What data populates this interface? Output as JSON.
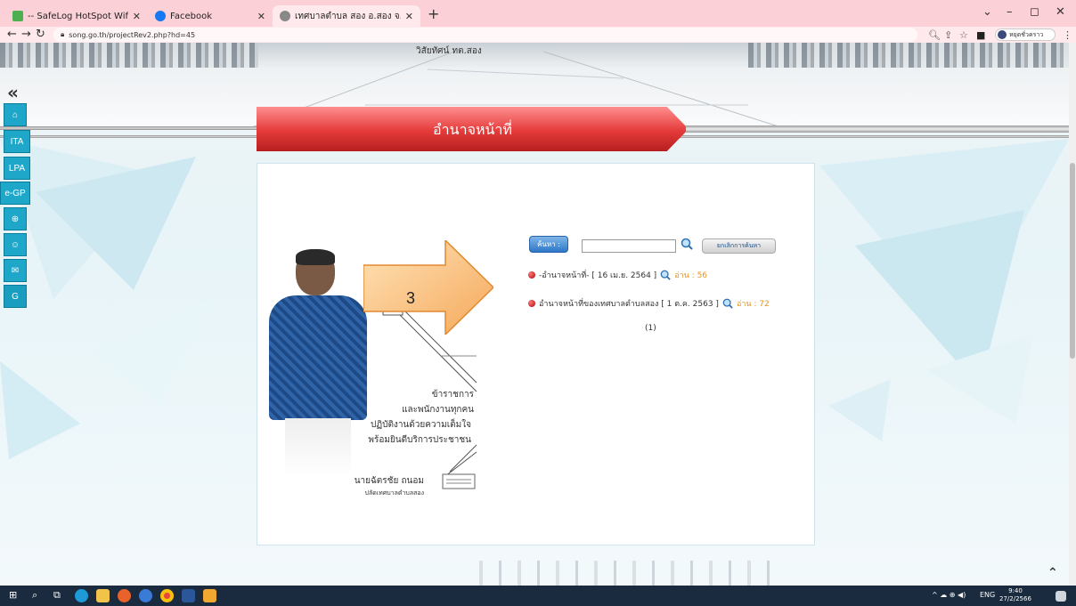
{
  "browser": {
    "tabs": [
      {
        "title": "-- SafeLog HotSpot Wifi Interne",
        "favicon_color": "#4caf50"
      },
      {
        "title": "Facebook",
        "favicon_color": "#1877f2"
      },
      {
        "title": "เทศบาลตำบล สอง อ.สอง จ.แพร่ Build",
        "favicon_color": "#888888"
      }
    ],
    "new_tab": "+",
    "url": "song.go.th/projectRev2.php?hd=45",
    "profile_label": "หยุดชั่วคราว",
    "window_controls": [
      "⌄",
      "–",
      "◻",
      "✕"
    ]
  },
  "page": {
    "banner_caption": "วิสัยทัศน์ ทต.สอง",
    "sidebar": {
      "collapse": "«",
      "buttons": [
        {
          "label": "⌂",
          "icon": "home-icon"
        },
        {
          "label": "ITA",
          "icon": ""
        },
        {
          "label": "LPA",
          "icon": ""
        },
        {
          "label": "e-GP",
          "icon": ""
        },
        {
          "label": "",
          "icon": "egp-globe-icon"
        },
        {
          "label": "",
          "icon": "user-icon"
        },
        {
          "label": "",
          "icon": "mail-icon"
        },
        {
          "label": "",
          "icon": "translate-icon"
        }
      ]
    },
    "section_title": "อำนาจหน้าที่",
    "poster": {
      "line1": "ข้าราชการ",
      "line2": "และพนักงานทุกคน",
      "line3": "ปฏิบัติงานด้วยความเต็มใจ",
      "line4": "พร้อมยินดีบริการประชาชน",
      "name": "นายฉัตรชัย  ถนอม",
      "position": "ปลัดเทศบาลตำบลสอง"
    },
    "annotation_number": "3",
    "search": {
      "button": "ค้นหา :",
      "value": "",
      "cancel": "ยกเลิกการค้นหา"
    },
    "items": [
      {
        "title": "-อำนาจหน้าที่- [ 16 เม.ย. 2564 ]",
        "reads": "อ่าน : 56"
      },
      {
        "title": "อำนาจหน้าที่ของเทศบาลตำบลสอง [ 1 ต.ค. 2563 ]",
        "reads": "อ่าน : 72"
      }
    ],
    "pager": "(1)"
  },
  "taskbar": {
    "language": "ENG",
    "time": "9:40",
    "date": "27/2/2566"
  }
}
